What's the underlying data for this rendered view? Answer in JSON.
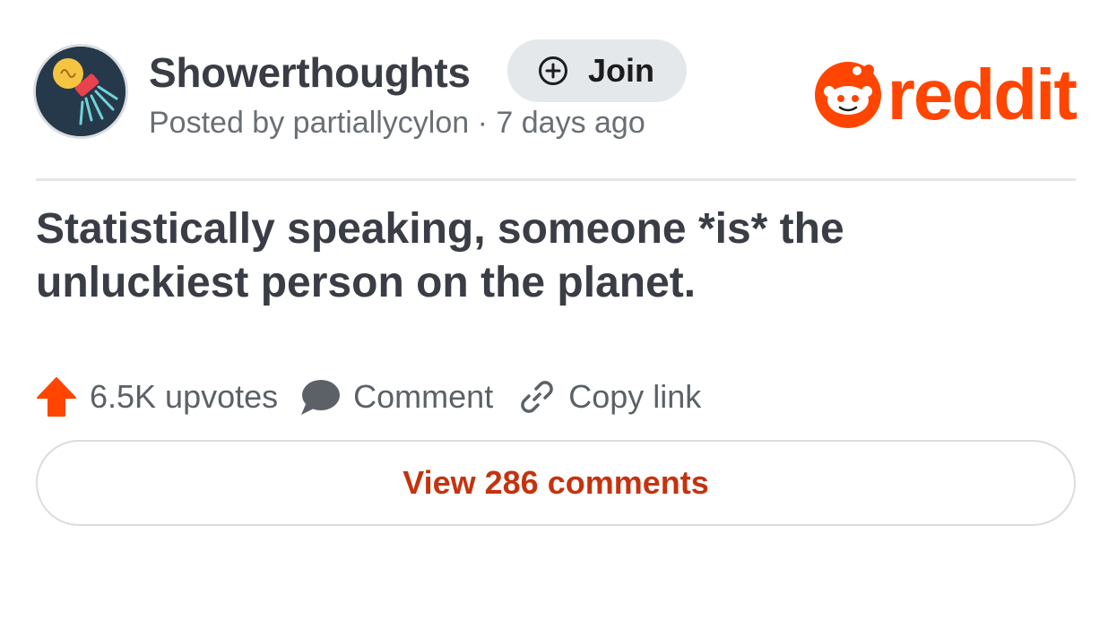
{
  "subreddit": {
    "name": "Showerthoughts",
    "join_label": "Join",
    "meta": "Posted by partiallycylon · 7 days ago",
    "avatar_icon": "lightbulb-shower-icon"
  },
  "brand": {
    "wordmark": "reddit",
    "icon": "snoo-icon",
    "color": "#ff4500"
  },
  "post": {
    "title": "Statistically speaking, someone *is* the unluckiest person on the planet."
  },
  "actions": {
    "upvotes_label": "6.5K upvotes",
    "comment_label": "Comment",
    "copy_link_label": "Copy link"
  },
  "footer": {
    "view_comments_label": "View 286 comments"
  },
  "colors": {
    "accent": "#ff4500",
    "link_text": "#c4330e",
    "meta_text": "#6a6f76"
  }
}
